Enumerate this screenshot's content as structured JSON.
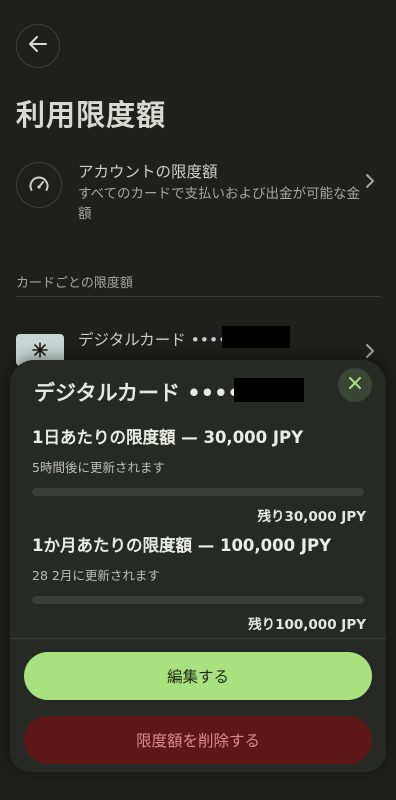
{
  "page": {
    "title": "利用限度額",
    "back_icon": "arrow-left-icon"
  },
  "account_limit": {
    "title": "アカウントの限度額",
    "description": "すべてのカードで支払いおよび出金が可能な金額",
    "icon": "gauge-icon"
  },
  "section": {
    "label": "カードごとの限度額"
  },
  "card_row": {
    "title": "デジタルカード ••••"
  },
  "sheet": {
    "title": "デジタルカード ••••",
    "close_icon": "close-icon",
    "limits": [
      {
        "title": "1日あたりの限度額 — 30,000 JPY",
        "subtitle": "5時間後に更新されます",
        "used_fraction": 0,
        "remaining": "残り30,000 JPY"
      },
      {
        "title": "1か月あたりの限度額 — 100,000 JPY",
        "subtitle": "28 2月に更新されます",
        "used_fraction": 0,
        "remaining": "残り100,000 JPY"
      }
    ],
    "edit_label": "編集する",
    "delete_label": "限度額を削除する"
  },
  "colors": {
    "background": "#1f1f1c",
    "sheet": "#272a24",
    "accent": "#a7e27e",
    "danger_bg": "#5e1717",
    "danger_text": "#d98c8c"
  }
}
